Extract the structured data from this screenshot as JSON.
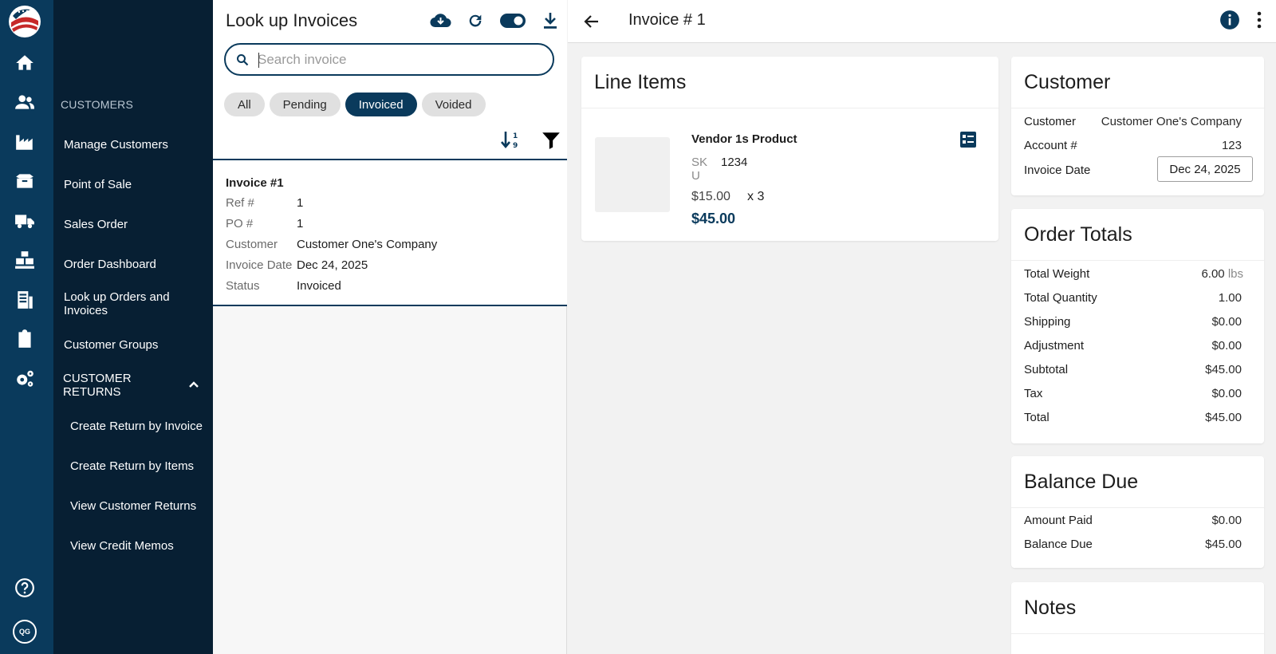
{
  "brand": {
    "logo": "flag-eagle-logo"
  },
  "rail": {
    "icons": [
      "home-icon",
      "users-icon",
      "factory-icon",
      "box-icon",
      "delivery-truck-icon",
      "warehouse-icon",
      "invoice-machine-icon",
      "clipboard-icon",
      "gears-icon"
    ],
    "bottom": {
      "help": "help-icon",
      "avatar_initials": "QG"
    }
  },
  "nav": {
    "section_label": "CUSTOMERS",
    "items": [
      "Manage Customers",
      "Point of Sale",
      "Sales Order",
      "Order Dashboard",
      "Look up Orders and Invoices",
      "Customer Groups"
    ],
    "group_label": "CUSTOMER RETURNS",
    "sub_items": [
      "Create Return by Invoice",
      "Create Return by Items",
      "View Customer Returns",
      "View Credit Memos"
    ]
  },
  "list": {
    "title": "Look up Invoices",
    "search_placeholder": "Search invoice",
    "filters": [
      "All",
      "Pending",
      "Invoiced",
      "Voided"
    ],
    "active_filter": "Invoiced",
    "invoice": {
      "title": "Invoice #1",
      "fields": [
        {
          "label": "Ref #",
          "value": "1"
        },
        {
          "label": "PO #",
          "value": "1"
        },
        {
          "label": "Customer",
          "value": "Customer One's Company"
        },
        {
          "label": "Invoice Date",
          "value": "Dec 24, 2025"
        },
        {
          "label": "Status",
          "value": "Invoiced"
        }
      ]
    }
  },
  "detail": {
    "title": "Invoice # 1",
    "line_items": {
      "heading": "Line Items",
      "product_name": "Vendor 1s Product",
      "sku_label": "SKU",
      "sku_value": "1234",
      "unit_price": "$15.00",
      "quantity": "x 3",
      "line_total": "$45.00"
    },
    "customer": {
      "heading": "Customer",
      "rows": [
        {
          "label": "Customer",
          "value": "Customer One's Company"
        },
        {
          "label": "Account #",
          "value": "123"
        }
      ],
      "invoice_date_label": "Invoice Date",
      "invoice_date_value": "Dec 24, 2025"
    },
    "order_totals": {
      "heading": "Order Totals",
      "weight_label": "Total Weight",
      "weight_value": "6.00",
      "weight_unit": "lbs",
      "rows": [
        {
          "label": "Total Quantity",
          "value": "1.00"
        },
        {
          "label": "Shipping",
          "value": "$0.00"
        },
        {
          "label": "Adjustment",
          "value": "$0.00"
        },
        {
          "label": "Subtotal",
          "value": "$45.00"
        },
        {
          "label": "Tax",
          "value": "$0.00"
        },
        {
          "label": "Total",
          "value": "$45.00"
        }
      ]
    },
    "balance_due": {
      "heading": "Balance Due",
      "rows": [
        {
          "label": "Amount Paid",
          "value": "$0.00"
        },
        {
          "label": "Balance Due",
          "value": "$45.00"
        }
      ]
    },
    "notes": {
      "heading": "Notes"
    }
  },
  "colors": {
    "primary": "#0a3a5c",
    "rail": "#0a3a5c",
    "nav": "#071f33",
    "chip": "#e0e0e0"
  }
}
